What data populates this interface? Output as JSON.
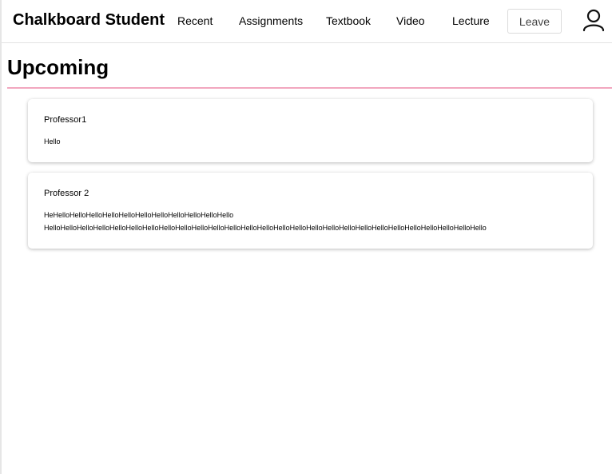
{
  "navbar": {
    "brand": "Chalkboard Student",
    "links": [
      "Recent",
      "Assignments",
      "Textbook",
      "Video",
      "Lecture"
    ],
    "leave_label": "Leave",
    "user_icon": "user-icon"
  },
  "main": {
    "title": "Upcoming",
    "accent_color": "#f2a7bf",
    "posts": [
      {
        "author": "Professor1",
        "lines": [
          "Hello"
        ]
      },
      {
        "author": "Professor 2",
        "lines": [
          "HeHelloHelloHelloHelloHelloHelloHelloHelloHelloHelloHello",
          "HelloHelloHelloHelloHelloHelloHelloHelloHelloHelloHelloHelloHelloHelloHelloHelloHelloHelloHelloHelloHelloHelloHelloHelloHelloHelloHello"
        ]
      }
    ]
  }
}
